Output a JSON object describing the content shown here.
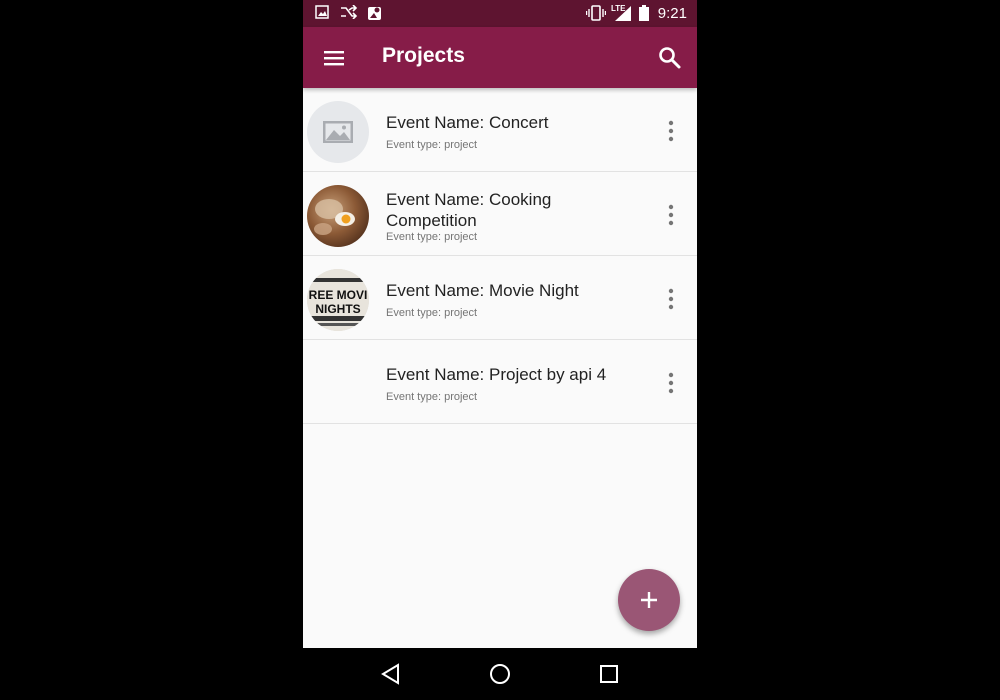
{
  "status_bar": {
    "time": "9:21",
    "network_label": "LTE",
    "icons": [
      "image-icon",
      "shuffle-icon",
      "map-icon",
      "vibrate-icon",
      "signal-icon",
      "battery-icon"
    ]
  },
  "app_bar": {
    "title": "Projects",
    "background": "#861c48",
    "menu_icon": "menu-icon",
    "search_icon": "search-icon"
  },
  "projects": [
    {
      "title": "Event Name: Concert",
      "subtitle": "Event type: project",
      "avatar": "placeholder-image"
    },
    {
      "title": "Event Name: Cooking Competition",
      "subtitle": "Event type: project",
      "avatar": "cooking-photo"
    },
    {
      "title": "Event Name: Movie Night",
      "subtitle": "Event type: project",
      "avatar": "movie-night-photo",
      "avatar_text": [
        "REE MOVI",
        "NIGHTS"
      ]
    },
    {
      "title": "Event Name: Project by api 4",
      "subtitle": "Event type: project",
      "avatar": "none"
    }
  ],
  "fab": {
    "icon": "plus-icon",
    "color": "#9a5675"
  },
  "nav_bar": {
    "icons": [
      "back-icon",
      "home-icon",
      "recents-icon"
    ]
  }
}
